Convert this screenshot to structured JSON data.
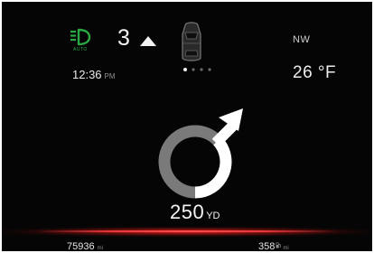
{
  "status": {
    "light_label": "AUTO",
    "gear": "3",
    "heading": "NW",
    "clock": "12:36",
    "clock_ampm": "PM",
    "temperature": "26 °F"
  },
  "navigation": {
    "distance_value": "250",
    "distance_unit": "YD",
    "page_indicator": {
      "count": 4,
      "active": 1
    }
  },
  "trip": {
    "odometer_value": "75936",
    "odometer_unit": "mi",
    "range_value": "358",
    "range_unit": "mi"
  },
  "colors": {
    "light_icon": "#2aa843",
    "route": "#ffffff",
    "roundabout_ring": "#7a7a7a",
    "accent_bar": "#e63a3a",
    "background": "#050505"
  },
  "icons": {
    "light": "auto-headlight-icon",
    "gear_arrow": "triangle-up-icon",
    "vehicle": "car-top-view-icon",
    "turn": "roundabout-exit-arrow-icon",
    "fuel": "fuel-pump-icon"
  }
}
